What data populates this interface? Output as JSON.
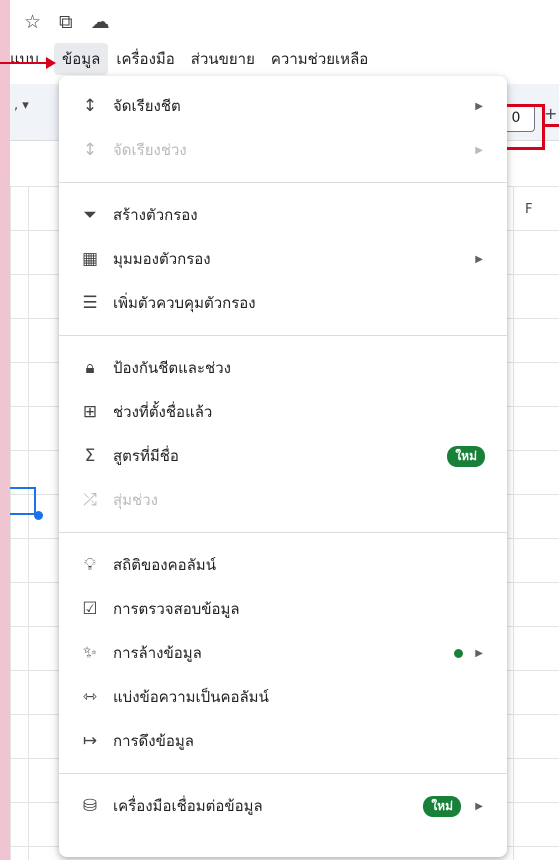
{
  "icons_top": [
    "star-icon",
    "folder-move-icon",
    "cloud-icon"
  ],
  "menubar": {
    "items": [
      {
        "label": "แบบ"
      },
      {
        "label": "ข้อมูล"
      },
      {
        "label": "เครื่องมือ"
      },
      {
        "label": "ส่วนขยาย"
      },
      {
        "label": "ความช่วยเหลือ"
      }
    ]
  },
  "toolbar": {
    "zoom_value": "0",
    "plus": "+"
  },
  "grid": {
    "column_f": "F"
  },
  "menu": {
    "sort_sheet": "จัดเรียงชีต",
    "sort_range": "จัดเรียงช่วง",
    "create_filter": "สร้างตัวกรอง",
    "filter_views": "มุมมองตัวกรอง",
    "add_slicer": "เพิ่มตัวควบคุมตัวกรอง",
    "protect": "ป้องกันชีตและช่วง",
    "named_ranges": "ช่วงที่ตั้งชื่อแล้ว",
    "named_functions": "สูตรที่มีชื่อ",
    "named_functions_badge": "ใหม่",
    "randomize": "สุ่มช่วง",
    "column_stats": "สถิติของคอลัมน์",
    "data_validation": "การตรวจสอบข้อมูล",
    "data_cleanup": "การล้างข้อมูล",
    "split_text": "แบ่งข้อความเป็นคอลัมน์",
    "data_extraction": "การดึงข้อมูล",
    "data_connectors": "เครื่องมือเชื่อมต่อข้อมูล",
    "data_connectors_badge": "ใหม่"
  },
  "colors": {
    "accent": "#1a73e8",
    "badge": "#188038",
    "annotation": "#d9001b"
  }
}
